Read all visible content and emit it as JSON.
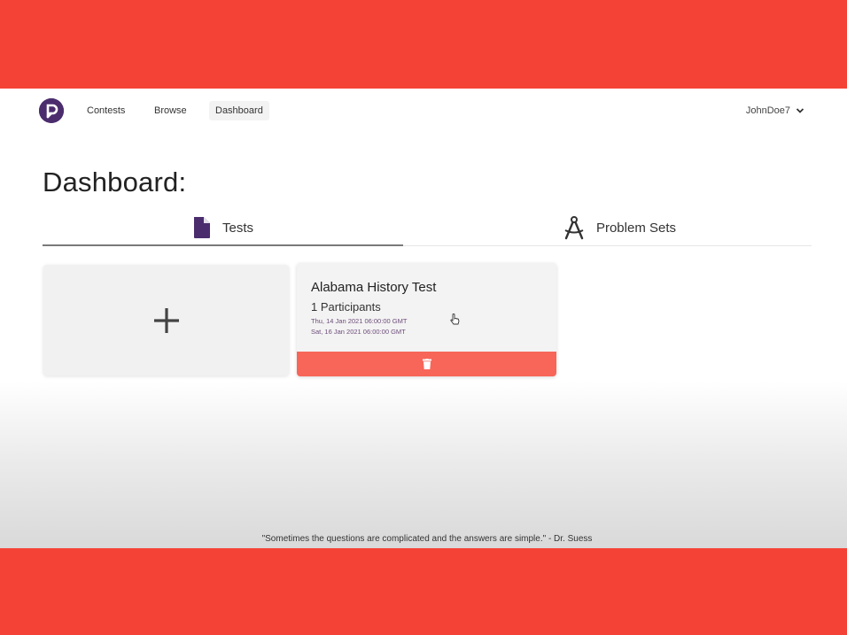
{
  "nav": {
    "logo": "p-logo-icon",
    "items": [
      {
        "label": "Contests"
      },
      {
        "label": "Browse"
      },
      {
        "label": "Dashboard",
        "active": true
      }
    ],
    "user": {
      "name": "JohnDoe7",
      "icon": "chevron-down-icon"
    }
  },
  "page": {
    "title": "Dashboard:"
  },
  "tabs": [
    {
      "label": "Tests",
      "icon": "document-icon",
      "active": true
    },
    {
      "label": "Problem Sets",
      "icon": "compass-icon",
      "active": false
    }
  ],
  "cards": {
    "add": {
      "icon": "plus-icon"
    },
    "tests": [
      {
        "title": "Alabama History Test",
        "participants": "1 Participants",
        "start": "Thu, 14 Jan 2021 06:00:00 GMT",
        "end": "Sat, 16 Jan 2021 06:00:00 GMT",
        "delete_icon": "trash-icon"
      }
    ]
  },
  "footer": {
    "quote": "\"Sometimes the questions are complicated and the answers are simple.\" - Dr. Suess"
  },
  "colors": {
    "banner": "#f44336",
    "brand": "#4b2d6e",
    "delete": "#f76659",
    "date_text": "#6d4d7a"
  }
}
